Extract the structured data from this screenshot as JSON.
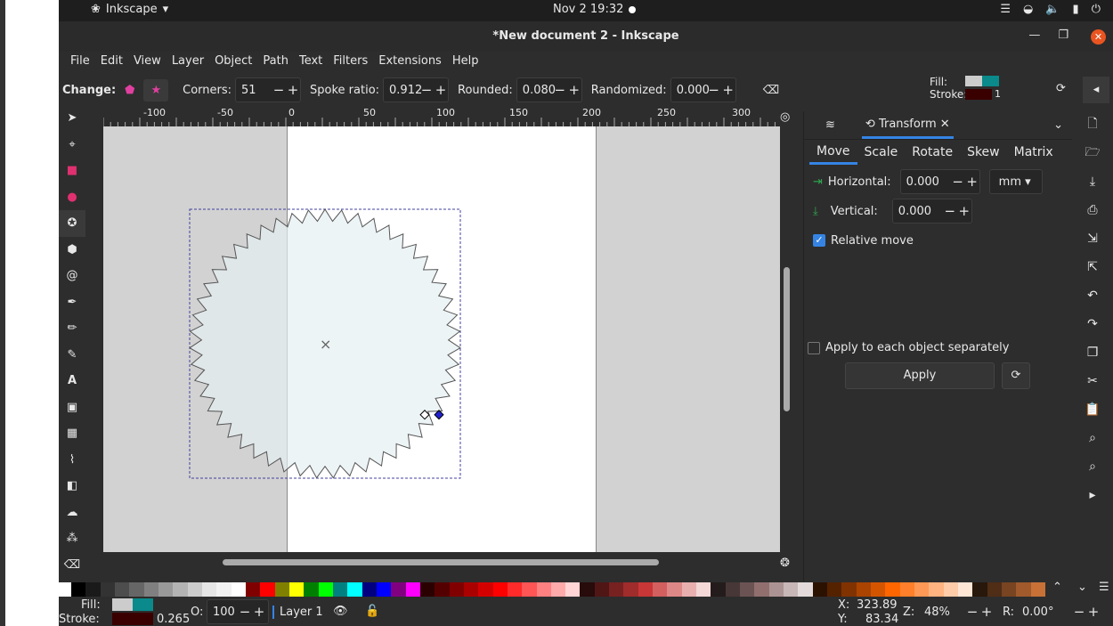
{
  "system": {
    "app_name": "Inkscape",
    "clock": "Nov 2  19:32"
  },
  "window": {
    "title": "*New document 2 - Inkscape"
  },
  "menu": [
    "File",
    "Edit",
    "View",
    "Layer",
    "Object",
    "Path",
    "Text",
    "Filters",
    "Extensions",
    "Help"
  ],
  "toolctrl": {
    "change": "Change:",
    "corners_label": "Corners:",
    "corners": "51",
    "spoke_label": "Spoke ratio:",
    "spoke": "0.912",
    "rounded_label": "Rounded:",
    "rounded": "0.080",
    "random_label": "Randomized:",
    "random": "0.000"
  },
  "fillstroke": {
    "fill": "Fill:",
    "stroke": "Stroke:",
    "stroke_w": "1"
  },
  "ruler_h": [
    "-100",
    "-50",
    "0",
    "50",
    "100",
    "150",
    "200",
    "250",
    "300"
  ],
  "dock": {
    "tab": "Transform",
    "subtabs": [
      "Move",
      "Scale",
      "Rotate",
      "Skew",
      "Matrix"
    ],
    "horizontal_label": "Horizontal:",
    "horizontal": "0.000",
    "unit": "mm",
    "vertical_label": "Vertical:",
    "vertical": "0.000",
    "relative": "Relative move",
    "apply_each": "Apply to each object separately",
    "apply": "Apply"
  },
  "status": {
    "fill": "Fill:",
    "stroke": "Stroke:",
    "stroke_w": "0.265",
    "o_label": "O:",
    "opacity": "100",
    "layer": "Layer 1",
    "x_label": "X:",
    "x": "323.89",
    "y_label": "Y:",
    "y": "83.34",
    "z_label": "Z:",
    "zoom": "48%",
    "r_label": "R:",
    "rotation": "0.00°"
  },
  "palette": [
    "#000000",
    "#1a1a1a",
    "#333333",
    "#4d4d4d",
    "#666666",
    "#808080",
    "#999999",
    "#b3b3b3",
    "#cccccc",
    "#e6e6e6",
    "#f2f2f2",
    "#ffffff",
    "#800000",
    "#ff0000",
    "#808000",
    "#ffff00",
    "#008000",
    "#00ff00",
    "#008080",
    "#00ffff",
    "#000080",
    "#0000ff",
    "#800080",
    "#ff00ff",
    "#2b0000",
    "#550000",
    "#800000",
    "#aa0000",
    "#d40000",
    "#ff0000",
    "#ff2a2a",
    "#ff5555",
    "#ff8080",
    "#ffaaaa",
    "#ffd5d5",
    "#280b0b",
    "#501616",
    "#782121",
    "#a02c2c",
    "#c83737",
    "#d35f5f",
    "#de8787",
    "#e9afaf",
    "#f4d7d7",
    "#241c1c",
    "#483737",
    "#6c5353",
    "#916f6f",
    "#ac9393",
    "#c8b7b7",
    "#e3dbdb",
    "#2b1100",
    "#552200",
    "#803300",
    "#aa4400",
    "#d45500",
    "#ff6600",
    "#ff7f2a",
    "#ff9955",
    "#ffb380",
    "#ffccaa",
    "#ffe6d5",
    "#28170b",
    "#502d16",
    "#784421",
    "#a05a2c",
    "#c87137"
  ]
}
